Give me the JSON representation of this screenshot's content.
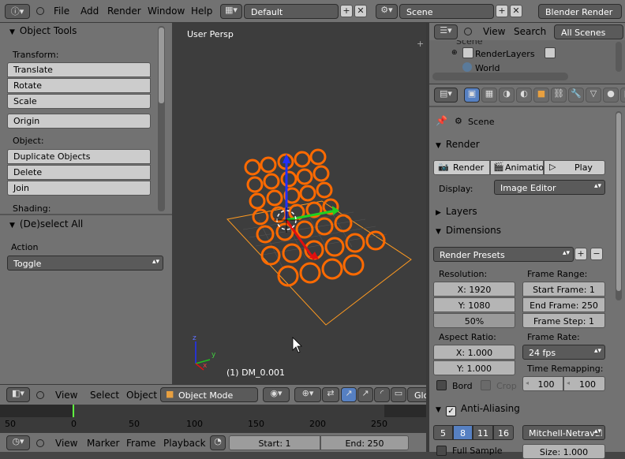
{
  "topbar": {
    "menus": [
      "File",
      "Add",
      "Render",
      "Window",
      "Help"
    ],
    "screen_layout": "Default",
    "scene": "Scene",
    "engine": "Blender Render"
  },
  "tool_shelf": {
    "title": "Object Tools",
    "transform_label": "Transform:",
    "transform": [
      "Translate",
      "Rotate",
      "Scale"
    ],
    "origin": "Origin",
    "object_label": "Object:",
    "object": [
      "Duplicate Objects",
      "Delete",
      "Join"
    ],
    "shading_label": "Shading:",
    "operator_title": "(De)select All",
    "action_label": "Action",
    "action_value": "Toggle"
  },
  "viewport": {
    "persp": "User Persp",
    "object_name": "(1) DM_0.001",
    "axis_y": "y",
    "axis_z": "z",
    "axis_x": "x"
  },
  "view3d_header": {
    "menus": [
      "View",
      "Select",
      "Object"
    ],
    "mode": "Object Mode",
    "global": "Glob"
  },
  "timeline": {
    "ticks": [
      "50",
      "0",
      "50",
      "100",
      "150",
      "200",
      "250"
    ],
    "menus": [
      "View",
      "Marker",
      "Frame",
      "Playback"
    ],
    "start": "Start: 1",
    "end": "End: 250"
  },
  "outliner": {
    "menus": [
      "View",
      "Search"
    ],
    "filter": "All Scenes",
    "items": [
      "Scene",
      "RenderLayers",
      "World"
    ]
  },
  "properties": {
    "scene_label": "Scene",
    "render_section": "Render",
    "render_btn": "Render",
    "animation_btn": "Animation",
    "play_btn": "Play",
    "display_label": "Display:",
    "display_value": "Image Editor",
    "layers_section": "Layers",
    "dimensions_section": "Dimensions",
    "presets": "Render Presets",
    "resolution_label": "Resolution:",
    "res_x": "X: 1920",
    "res_y": "Y: 1080",
    "res_pct": "50%",
    "frame_range_label": "Frame Range:",
    "start_frame": "Start Frame: 1",
    "end_frame": "End Frame: 250",
    "frame_step": "Frame Step: 1",
    "aspect_label": "Aspect Ratio:",
    "aspect_x": "X: 1.000",
    "aspect_y": "Y: 1.000",
    "frame_rate_label": "Frame Rate:",
    "fps": "24 fps",
    "bord": "Bord",
    "crop": "Crop",
    "time_remap_label": "Time Remapping:",
    "remap_old": "100",
    "remap_new": "100",
    "aa_section": "Anti-Aliasing",
    "aa_samples": [
      "5",
      "8",
      "11",
      "16"
    ],
    "aa_filter": "Mitchell-Netraval",
    "full_sample": "Full Sample",
    "size": "Size: 1.000"
  },
  "colors": {
    "accent": "#5680c2",
    "selection": "#ff6a00",
    "bg": "#727272"
  }
}
